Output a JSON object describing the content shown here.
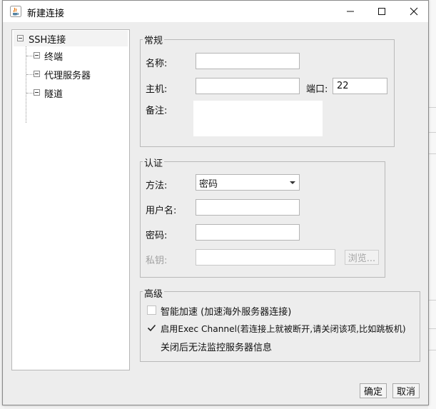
{
  "window": {
    "title": "新建连接",
    "icons": {
      "app": "java-cup-icon",
      "minimize": "minimize-icon",
      "maximize": "maximize-icon",
      "close": "close-icon"
    }
  },
  "tree": {
    "root": "SSH连接",
    "children": [
      "终端",
      "代理服务器",
      "隧道"
    ]
  },
  "general": {
    "legend": "常规",
    "name_label": "名称:",
    "name_value": "",
    "host_label": "主机:",
    "host_value": "",
    "port_label": "端口:",
    "port_value": "22",
    "note_label": "备注:",
    "note_value": ""
  },
  "auth": {
    "legend": "认证",
    "method_label": "方法:",
    "method_value": "密码",
    "username_label": "用户名:",
    "username_value": "",
    "password_label": "密码:",
    "password_value": "",
    "key_label": "私钥:",
    "key_value": "",
    "browse_label": "浏览..."
  },
  "advanced": {
    "legend": "高级",
    "smart_accel_label": "智能加速 (加速海外服务器连接)",
    "smart_accel_checked": false,
    "exec_channel_label": "启用Exec Channel(若连接上就被断开,请关闭该项,比如跳板机)",
    "exec_channel_checked": true,
    "exec_channel_note": "关闭后无法监控服务器信息"
  },
  "buttons": {
    "ok": "确定",
    "cancel": "取消"
  },
  "colors": {
    "window_bg": "#ededed",
    "titlebar_bg": "#ffffff",
    "disabled_text": "#a0a0a0"
  }
}
